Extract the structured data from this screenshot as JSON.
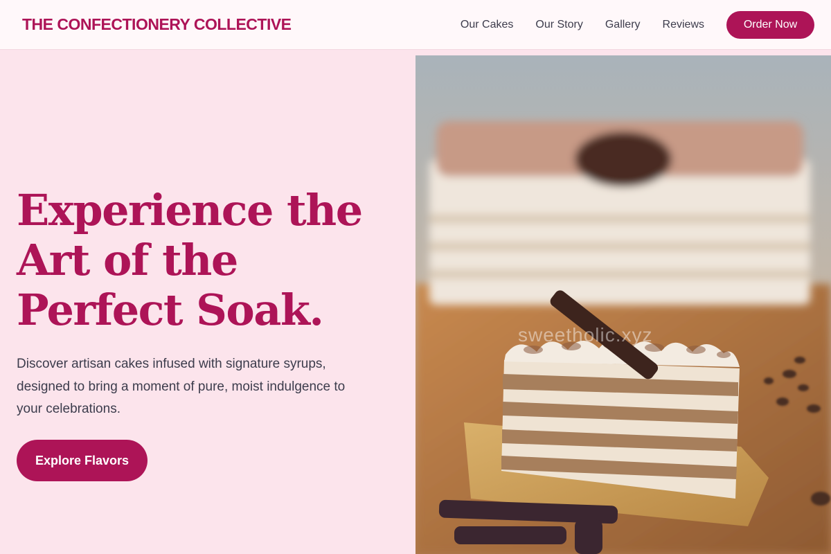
{
  "brand": {
    "name": "THE CONFECTIONERY COLLECTIVE"
  },
  "nav": {
    "links": [
      "Our Cakes",
      "Our Story",
      "Gallery",
      "Reviews"
    ],
    "cta": "Order Now"
  },
  "hero": {
    "title_lines": [
      "Experience the",
      "Art of the",
      "Perfect Soak."
    ],
    "subtitle_lines": [
      "Discover artisan cakes infused with signature syrups,",
      "designed to bring a moment of pure, moist indulgence to",
      "your celebrations."
    ],
    "cta": "Explore Flavors",
    "image": {
      "watermark": "sweetholic.xyz"
    }
  },
  "colors": {
    "brand": "#ad1457",
    "page_background": "#fce4ec",
    "header_background": "#fff8fa",
    "body_text": "#3c3c4c"
  }
}
